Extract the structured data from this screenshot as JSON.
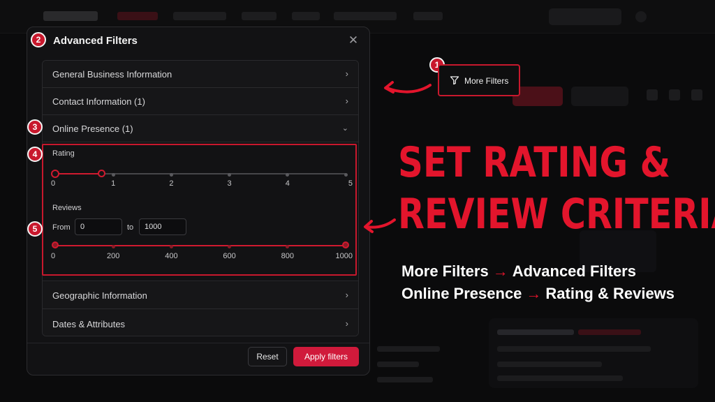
{
  "modal": {
    "title": "Advanced Filters",
    "close_icon": "close-icon",
    "sections": [
      {
        "label": "General Business Information",
        "state": "collapsed"
      },
      {
        "label": "Contact Information (1)",
        "state": "collapsed"
      },
      {
        "label": "Online Presence (1)",
        "state": "expanded"
      },
      {
        "label": "Geographic Information",
        "state": "collapsed"
      },
      {
        "label": "Dates & Attributes",
        "state": "collapsed"
      }
    ],
    "rating": {
      "label": "Rating",
      "ticks": [
        "0",
        "1",
        "2",
        "3",
        "4",
        "5"
      ],
      "selected_min": 0,
      "selected_max": 0.8
    },
    "reviews": {
      "label": "Reviews",
      "from_label": "From",
      "to_label": "to",
      "from_value": "0",
      "to_value": "1000",
      "ticks": [
        "0",
        "200",
        "400",
        "600",
        "800",
        "1000"
      ],
      "selected_min": 0,
      "selected_max": 1000
    },
    "footer": {
      "reset_label": "Reset",
      "apply_label": "Apply filters"
    }
  },
  "callouts": {
    "badges": [
      "1",
      "2",
      "3",
      "4",
      "5"
    ],
    "more_filters_label": "More Filters",
    "more_filters_icon": "filter-icon",
    "headline_line1": "SET RATING &",
    "headline_line2": "REVIEW CRITERIA",
    "path1_a": "More Filters",
    "path1_b": "Advanced Filters",
    "path2_a": "Online Presence",
    "path2_b": "Rating & Reviews",
    "arrow_glyph": "→"
  },
  "colors": {
    "accent": "#d01a3b",
    "highlight": "#c8182d",
    "headline": "#e3152c",
    "background": "#0b0b0c",
    "panel": "#121214"
  }
}
